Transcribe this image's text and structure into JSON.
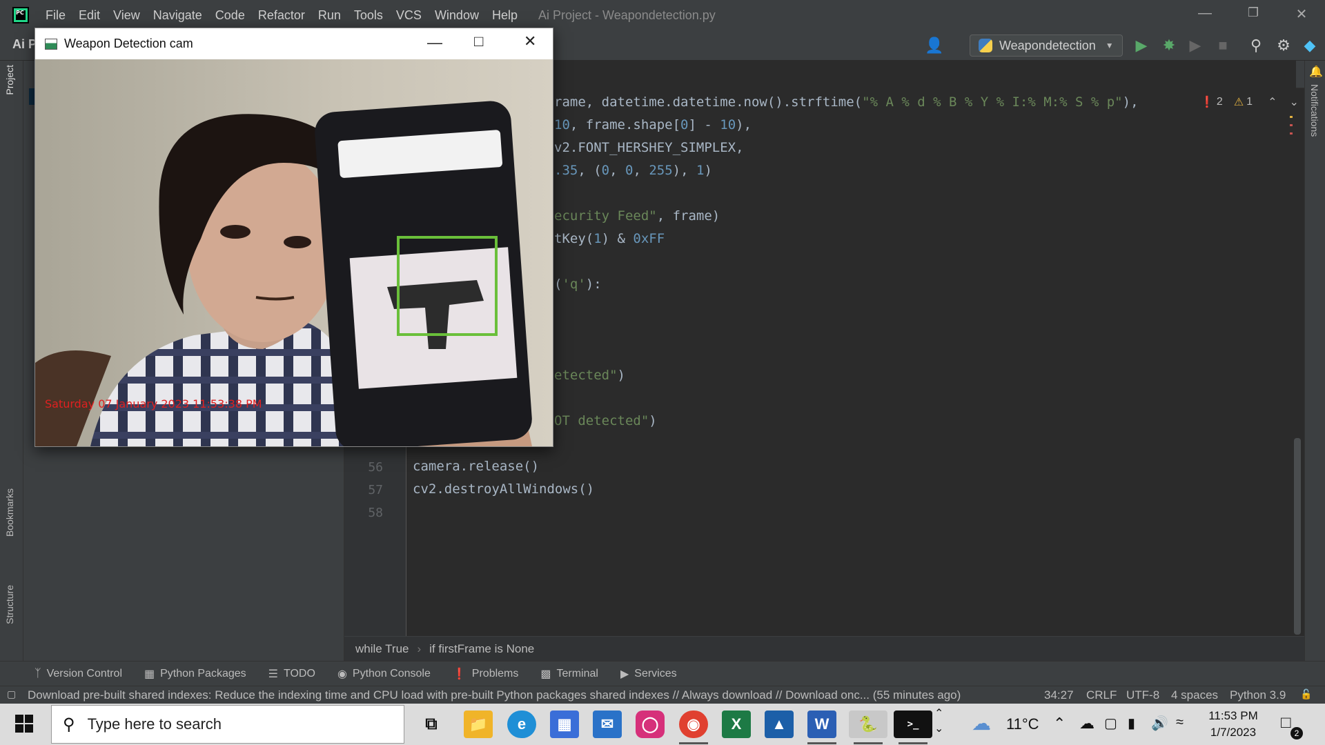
{
  "titlebar": {
    "menu": [
      "File",
      "Edit",
      "View",
      "Navigate",
      "Code",
      "Refactor",
      "Run",
      "Tools",
      "VCS",
      "Window",
      "Help"
    ],
    "window_title": "Ai Project - Weapondetection.py"
  },
  "toolbar": {
    "project_label": "Ai P",
    "run_config": "Weapondetection"
  },
  "side_labels": {
    "project": "Project",
    "bookmarks": "Bookmarks",
    "structure": "Structure",
    "notifications": "Notifications"
  },
  "editor": {
    "error_count": "2",
    "warning_count": "1",
    "visible_lines": [
      {
        "num": "",
        "parts": [
          [
            "rame, datetime.datetime.now().strftime(",
            "d"
          ],
          [
            "\"% A % d % B % Y % I:% M:% S % p\"",
            "s"
          ],
          [
            "),",
            "d"
          ]
        ]
      },
      {
        "num": "",
        "parts": [
          [
            "10",
            "n"
          ],
          [
            ", frame.shape[",
            "d"
          ],
          [
            "0",
            "n"
          ],
          [
            "] - ",
            "d"
          ],
          [
            "10",
            "n"
          ],
          [
            "),",
            "d"
          ]
        ]
      },
      {
        "num": "",
        "parts": [
          [
            "v2.FONT_HERSHEY_SIMPLEX,",
            "d"
          ]
        ]
      },
      {
        "num": "",
        "parts": [
          [
            ".35",
            "n"
          ],
          [
            ", (",
            "d"
          ],
          [
            "0",
            "n"
          ],
          [
            ", ",
            "d"
          ],
          [
            "0",
            "n"
          ],
          [
            ", ",
            "d"
          ],
          [
            "255",
            "n"
          ],
          [
            "), ",
            "d"
          ],
          [
            "1",
            "n"
          ],
          [
            ")",
            "d"
          ]
        ]
      },
      {
        "num": "",
        "parts": []
      },
      {
        "num": "",
        "parts": [
          [
            "ecurity Feed\"",
            "s"
          ],
          [
            ", frame)",
            "d"
          ]
        ]
      },
      {
        "num": "",
        "parts": [
          [
            "tKey(",
            "d"
          ],
          [
            "1",
            "n"
          ],
          [
            ") & ",
            "d"
          ],
          [
            "0xFF",
            "n"
          ]
        ]
      },
      {
        "num": "",
        "parts": []
      },
      {
        "num": "",
        "parts": [
          [
            "(",
            "d"
          ],
          [
            "'q'",
            "s"
          ],
          [
            "):",
            "d"
          ]
        ]
      },
      {
        "num": "",
        "parts": []
      },
      {
        "num": "",
        "parts": []
      },
      {
        "num": "",
        "parts": []
      },
      {
        "num": "",
        "parts": [
          [
            "etected\"",
            "s"
          ],
          [
            ")",
            "d"
          ]
        ]
      },
      {
        "num": "",
        "parts": []
      },
      {
        "num": "",
        "parts": [
          [
            "OT detected\"",
            "s"
          ],
          [
            ")",
            "d"
          ]
        ]
      },
      {
        "num": "",
        "parts": []
      },
      {
        "num": "56",
        "parts": [
          [
            "camera.release()",
            "d"
          ]
        ]
      },
      {
        "num": "57",
        "parts": [
          [
            "cv2.destroyAllWindows()",
            "d"
          ]
        ]
      },
      {
        "num": "58",
        "parts": []
      }
    ]
  },
  "breadcrumb": [
    "while True",
    "if firstFrame is None"
  ],
  "toolwindows": [
    {
      "icon": "version-control-icon",
      "label": "Version Control"
    },
    {
      "icon": "python-packages-icon",
      "label": "Python Packages"
    },
    {
      "icon": "todo-icon",
      "label": "TODO"
    },
    {
      "icon": "python-console-icon",
      "label": "Python Console"
    },
    {
      "icon": "problems-icon",
      "label": "Problems"
    },
    {
      "icon": "terminal-icon",
      "label": "Terminal"
    },
    {
      "icon": "services-icon",
      "label": "Services"
    }
  ],
  "statusbar": {
    "message": "Download pre-built shared indexes: Reduce the indexing time and CPU load with pre-built Python packages shared indexes // Always download // Download onc... (55 minutes ago)",
    "position": "34:27",
    "line_sep": "CRLF",
    "encoding": "UTF-8",
    "indent": "4 spaces",
    "interpreter": "Python 3.9"
  },
  "cam_window": {
    "title": "Weapon Detection cam",
    "timestamp": "Saturday 07 January 2023 11:53:38 PM"
  },
  "taskbar": {
    "search_placeholder": "Type here to search",
    "weather": "11°C",
    "time": "11:53 PM",
    "date": "1/7/2023",
    "notification_count": "2"
  },
  "colors": {
    "ide_bg": "#2b2b2b",
    "panel_bg": "#3c3f41",
    "string": "#6a8759",
    "number": "#6897bb",
    "detection_box": "#6abf3a",
    "timestamp_red": "#e02020"
  }
}
